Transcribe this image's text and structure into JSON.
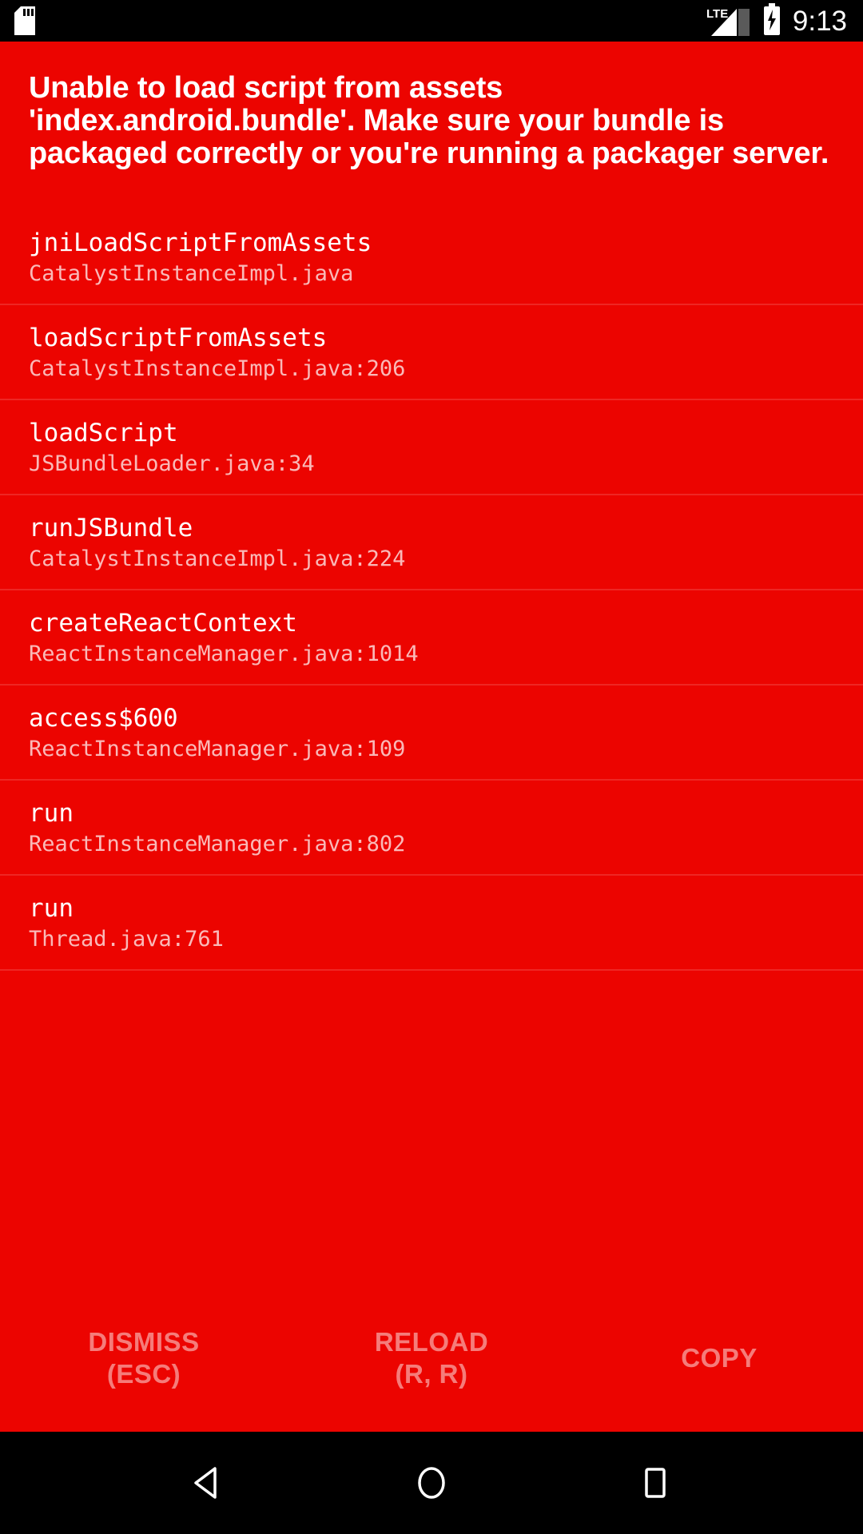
{
  "status_bar": {
    "sd_card_icon": "sd-card-icon",
    "network_label": "LTE",
    "signal_icon": "signal-bars-icon",
    "battery_icon": "battery-charging-icon",
    "clock": "9:13"
  },
  "error": {
    "title": "Unable to load script from assets 'index.android.bundle'. Make sure your bundle is packaged correctly or you're running a packager server.",
    "stack_frames": [
      {
        "method": "jniLoadScriptFromAssets",
        "file": "CatalystInstanceImpl.java"
      },
      {
        "method": "loadScriptFromAssets",
        "file": "CatalystInstanceImpl.java:206"
      },
      {
        "method": "loadScript",
        "file": "JSBundleLoader.java:34"
      },
      {
        "method": "runJSBundle",
        "file": "CatalystInstanceImpl.java:224"
      },
      {
        "method": "createReactContext",
        "file": "ReactInstanceManager.java:1014"
      },
      {
        "method": "access$600",
        "file": "ReactInstanceManager.java:109"
      },
      {
        "method": "run",
        "file": "ReactInstanceManager.java:802"
      },
      {
        "method": "run",
        "file": "Thread.java:761"
      }
    ]
  },
  "actions": [
    {
      "label": "DISMISS",
      "hint": "(ESC)"
    },
    {
      "label": "RELOAD",
      "hint": "(R, R)"
    },
    {
      "label": "COPY",
      "hint": ""
    }
  ],
  "nav_bar": {
    "back": "back-triangle-icon",
    "home": "home-circle-icon",
    "recents": "recents-square-icon"
  },
  "colors": {
    "background": "#EC0400",
    "status_bar": "#000000",
    "nav_bar": "#000000",
    "title_text": "#FFFFFF",
    "method_text": "#FFFFFF",
    "file_text": "rgba(255,255,255,0.72)",
    "action_text": "rgba(255,255,255,0.48)",
    "divider": "rgba(255,255,255,0.14)"
  }
}
